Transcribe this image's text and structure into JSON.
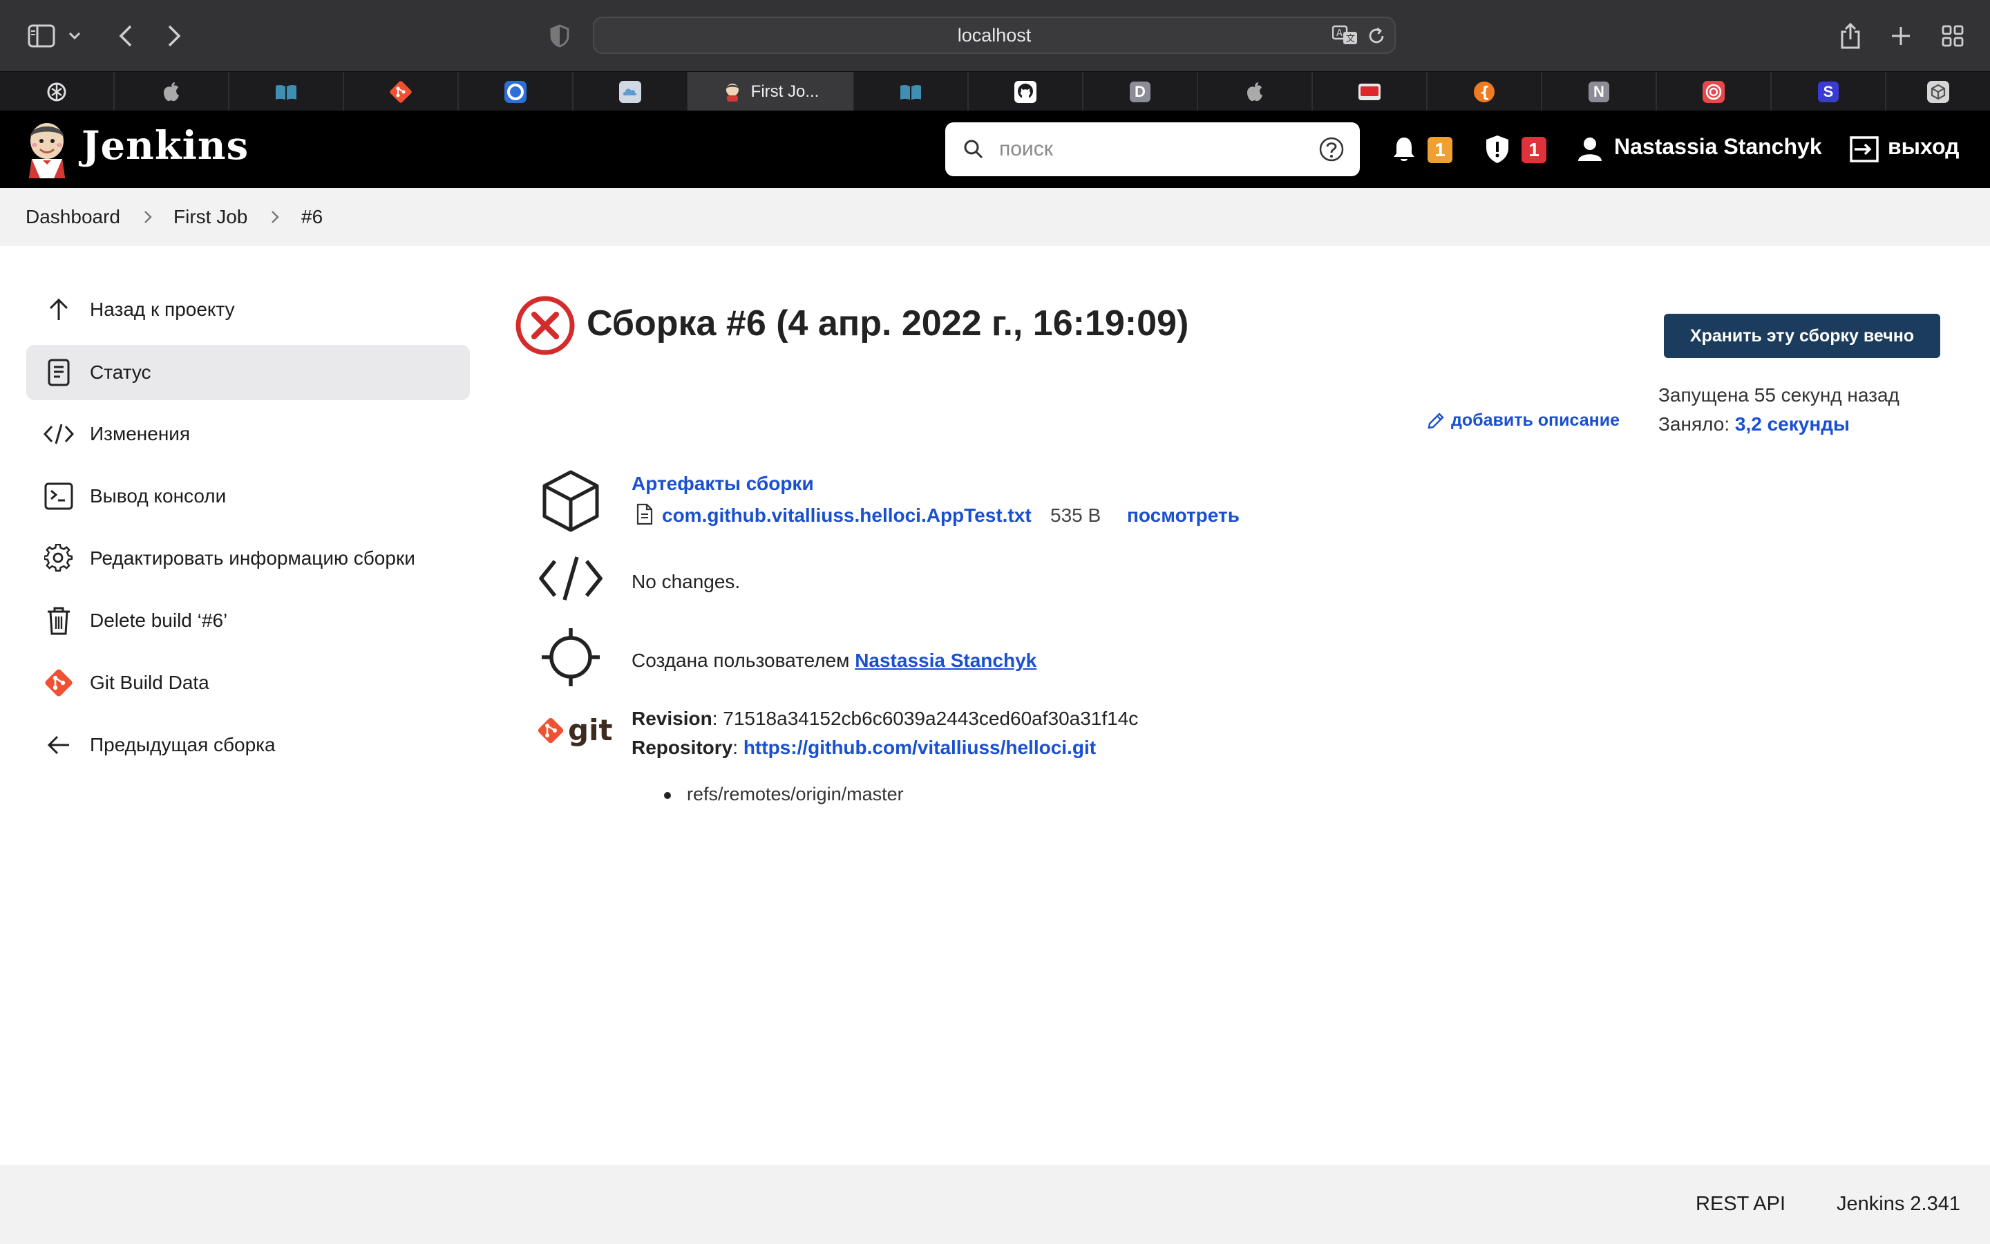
{
  "browser": {
    "url": "localhost",
    "tabs": [
      {
        "label": "",
        "icon": "openai-icon"
      },
      {
        "label": "",
        "icon": "apple-icon"
      },
      {
        "label": "",
        "icon": "book-icon"
      },
      {
        "label": "",
        "icon": "git-icon"
      },
      {
        "label": "",
        "icon": "circle-icon"
      },
      {
        "label": "",
        "icon": "cloud-icon"
      },
      {
        "label": "First Jo...",
        "icon": "jenkins-icon",
        "active": true
      },
      {
        "label": "",
        "icon": "book-icon"
      },
      {
        "label": "",
        "icon": "github-icon"
      },
      {
        "label": "D",
        "icon": "letter-d-icon"
      },
      {
        "label": "",
        "icon": "apple-icon"
      },
      {
        "label": "",
        "icon": "red-badge-icon"
      },
      {
        "label": "",
        "icon": "orange-brace-icon"
      },
      {
        "label": "N",
        "icon": "letter-n-icon"
      },
      {
        "label": "",
        "icon": "spiral-icon"
      },
      {
        "label": "S",
        "icon": "letter-s-icon"
      },
      {
        "label": "",
        "icon": "box-icon"
      }
    ]
  },
  "header": {
    "logo": "Jenkins",
    "search_placeholder": "поиск",
    "notifications_count": "1",
    "security_count": "1",
    "user_name": "Nastassia Stanchyk",
    "logout_label": "выход",
    "colors": {
      "notif_badge": "#f0a030",
      "security_badge": "#e0323a"
    }
  },
  "breadcrumb": [
    "Dashboard",
    "First Job",
    "#6"
  ],
  "sidebar": {
    "items": [
      {
        "label": "Назад к проекту",
        "icon": "arrow-up-icon"
      },
      {
        "label": "Статус",
        "icon": "document-icon",
        "active": true
      },
      {
        "label": "Изменения",
        "icon": "code-icon"
      },
      {
        "label": "Вывод консоли",
        "icon": "terminal-icon"
      },
      {
        "label": "Редактировать информацию сборки",
        "icon": "gear-icon"
      },
      {
        "label": "Delete build ‘#6’",
        "icon": "trash-icon"
      },
      {
        "label": "Git Build Data",
        "icon": "git-icon"
      },
      {
        "label": "Предыдущая сборка",
        "icon": "arrow-left-icon"
      }
    ]
  },
  "build": {
    "title": "Сборка #6 (4 апр. 2022 г., 16:19:09)",
    "status": "failed",
    "keep_forever_label": "Хранить эту сборку вечно",
    "started": "Запущена 55 секунд назад",
    "duration_label": "Заняло:",
    "duration_value": "3,2 секунды",
    "add_description": "добавить описание",
    "artifacts": {
      "heading": "Артефакты сборки",
      "file_name": "com.github.vitalliuss.helloci.AppTest.txt",
      "file_size": "535 B",
      "view_label": "посмотреть"
    },
    "changes": "No changes.",
    "created_by_label": "Создана пользователем",
    "created_by_user": "Nastassia Stanchyk",
    "git": {
      "logo_text": "git",
      "revision_label": "Revision",
      "revision_value": ": 71518a34152cb6c6039a2443ced60af30a31f14c",
      "repository_label": "Repository",
      "repository_sep": ": ",
      "repository_url": "https://github.com/vitalliuss/helloci.git",
      "branches": [
        "refs/remotes/origin/master"
      ]
    }
  },
  "footer": {
    "rest_api": "REST API",
    "version": "Jenkins 2.341"
  }
}
